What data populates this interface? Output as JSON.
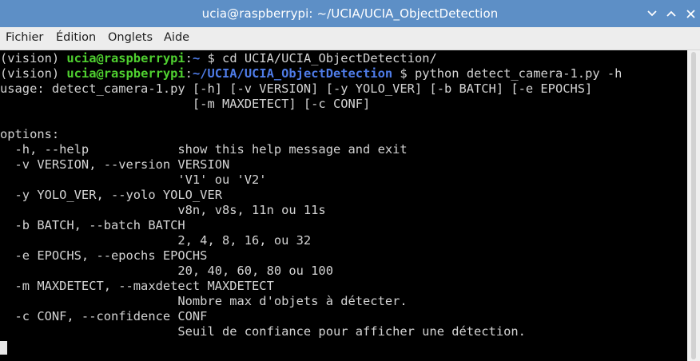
{
  "window": {
    "title": "ucia@raspberrypi: ~/UCIA/UCIA_ObjectDetection",
    "buttons": [
      "chevron-down-icon",
      "chevron-up-icon",
      "close-icon"
    ]
  },
  "menubar": {
    "items": [
      "Fichier",
      "Édition",
      "Onglets",
      "Aide"
    ]
  },
  "terminal": {
    "prompt1": {
      "env": "(vision) ",
      "userhost": "ucia@raspberrypi",
      "colon": ":",
      "path": "~",
      "dollar": " $ ",
      "command": "cd UCIA/UCIA_ObjectDetection/"
    },
    "prompt2": {
      "env": "(vision) ",
      "userhost": "ucia@raspberrypi",
      "colon": ":",
      "path": "~/UCIA/UCIA_ObjectDetection",
      "dollar": " $ ",
      "command": "python detect_camera-1.py -h"
    },
    "output": [
      "usage: detect_camera-1.py [-h] [-v VERSION] [-y YOLO_VER] [-b BATCH] [-e EPOCHS]",
      "                          [-m MAXDETECT] [-c CONF]",
      "",
      "options:",
      "  -h, --help            show this help message and exit",
      "  -v VERSION, --version VERSION",
      "                        'V1' ou 'V2'",
      "  -y YOLO_VER, --yolo YOLO_VER",
      "                        v8n, v8s, 11n ou 11s",
      "  -b BATCH, --batch BATCH",
      "                        2, 4, 8, 16, ou 32",
      "  -e EPOCHS, --epochs EPOCHS",
      "                        20, 40, 60, 80 ou 100",
      "  -m MAXDETECT, --maxdetect MAXDETECT",
      "                        Nombre max d'objets à détecter.",
      "  -c CONF, --confidence CONF",
      "                        Seuil de confiance pour afficher une détection."
    ]
  },
  "colors": {
    "titlebar": "#5d8fc6",
    "menubar": "#ededed",
    "terminal_bg": "#000000",
    "terminal_text": "#d4d4d4",
    "prompt_userhost": "#4fd030",
    "prompt_path": "#4f7ce8"
  }
}
